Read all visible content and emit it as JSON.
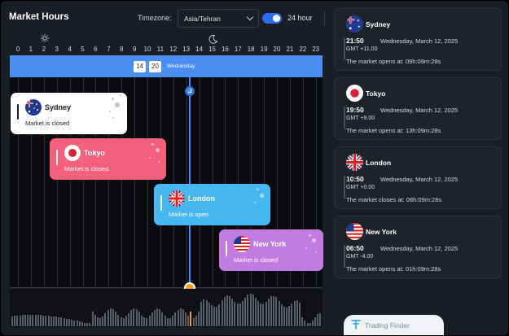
{
  "header": {
    "title": "Market Hours",
    "timezone_label": "Timezone:",
    "timezone_value": "Asia/Tehran",
    "toggle_label": "24 hour",
    "toggle_on": true
  },
  "timeline": {
    "hours": [
      "0",
      "1",
      "2",
      "3",
      "4",
      "5",
      "6",
      "7",
      "8",
      "9",
      "10",
      "11",
      "12",
      "13",
      "14",
      "15",
      "16",
      "17",
      "18",
      "19",
      "20",
      "21",
      "22",
      "23"
    ],
    "current_hour": "14",
    "current_minute": "20",
    "current_day": "Wednesday",
    "day_icon": "sun-icon",
    "night_icon": "moon-icon"
  },
  "markets": [
    {
      "name": "Sydney",
      "status": "Market is closed",
      "color": "#ffffff"
    },
    {
      "name": "Tokyo",
      "status": "Market is closed",
      "color": "#f2607c"
    },
    {
      "name": "London",
      "status": "Market is open",
      "color": "#46b7f0"
    },
    {
      "name": "New York",
      "status": "Market is closed",
      "color": "#c27be0"
    }
  ],
  "sidebar": [
    {
      "name": "Sydney",
      "time": "21:50",
      "date": "Wednesday, March 12, 2025",
      "gmt": "GMT +11.00",
      "message": "The market opens at: 09h:09m:28s"
    },
    {
      "name": "Tokyo",
      "time": "19:50",
      "date": "Wednesday, March 12, 2025",
      "gmt": "GMT +9.00",
      "message": "The market opens at: 13h:09m:28s"
    },
    {
      "name": "London",
      "time": "10:50",
      "date": "Wednesday, March 12, 2025",
      "gmt": "GMT +0.00",
      "message": "The market closes at: 06h:09m:28s"
    },
    {
      "name": "New York",
      "time": "06:50",
      "date": "Wednesday, March 12, 2025",
      "gmt": "GMT -4.00",
      "message": "The market opens at: 01h:09m:28s"
    }
  ],
  "brand": {
    "label": "Trading Finder"
  },
  "colors": {
    "accent": "#4a8ef1",
    "now_marker": "#f2a02a",
    "background": "#1b1d24"
  }
}
